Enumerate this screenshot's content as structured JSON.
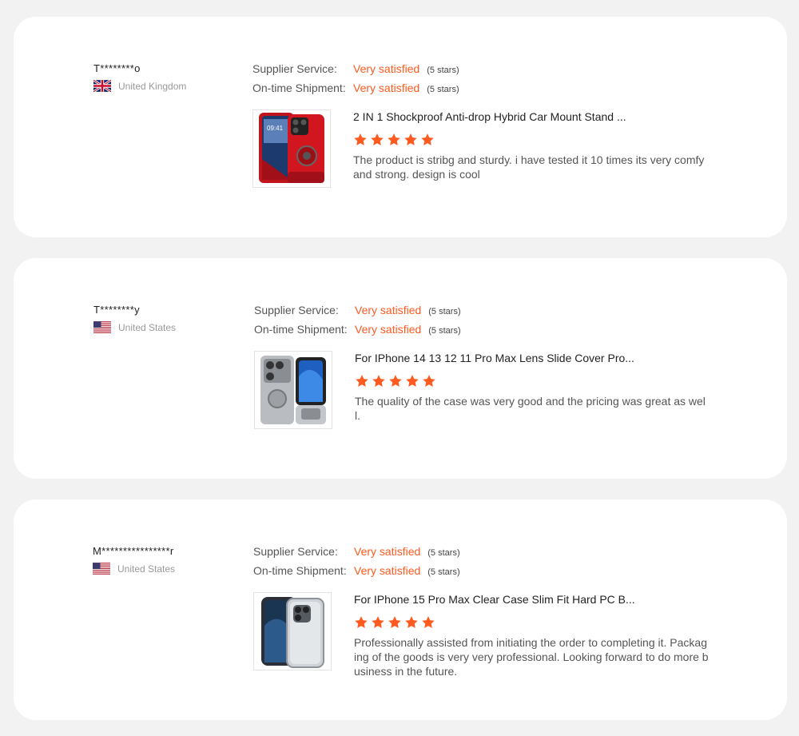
{
  "colors": {
    "accent": "#ff5a1f",
    "card_bg": "#ffffff",
    "page_bg": "#f2f2f2"
  },
  "reviews": [
    {
      "buyer_name": "T********o",
      "country": "United Kingdom",
      "flag_icon": "uk-flag-icon",
      "supplier_service_label": "Supplier Service:",
      "supplier_service_value": "Very satisfied",
      "supplier_service_stars": "(5 stars)",
      "shipment_label": "On-time Shipment:",
      "shipment_value": "Very satisfied",
      "shipment_stars": "(5 stars)",
      "product_title": "2 IN 1 Shockproof Anti-drop Hybrid Car Mount Stand ...",
      "rating": 5,
      "review_text": "The product is stribg and sturdy. i have tested it 10 times its very comfy and strong. design is cool"
    },
    {
      "buyer_name": "T********y",
      "country": "United States",
      "flag_icon": "us-flag-icon",
      "supplier_service_label": "Supplier Service:",
      "supplier_service_value": "Very satisfied",
      "supplier_service_stars": "(5 stars)",
      "shipment_label": "On-time Shipment:",
      "shipment_value": "Very satisfied",
      "shipment_stars": "(5 stars)",
      "product_title": "For IPhone 14 13 12 11 Pro Max Lens Slide Cover Pro...",
      "rating": 5,
      "review_text": "The quality of the case was very good and the pricing was great as well."
    },
    {
      "buyer_name": "M****************r",
      "country": "United States",
      "flag_icon": "us-flag-icon",
      "supplier_service_label": "Supplier Service:",
      "supplier_service_value": "Very satisfied",
      "supplier_service_stars": "(5 stars)",
      "shipment_label": "On-time Shipment:",
      "shipment_value": "Very satisfied",
      "shipment_stars": "(5 stars)",
      "product_title": "For IPhone 15 Pro Max Clear Case Slim Fit Hard PC B...",
      "rating": 5,
      "review_text": "Professionally assisted from initiating the order to completing it. Packaging of the goods is very very professional. Looking forward to do more business in the future."
    }
  ]
}
